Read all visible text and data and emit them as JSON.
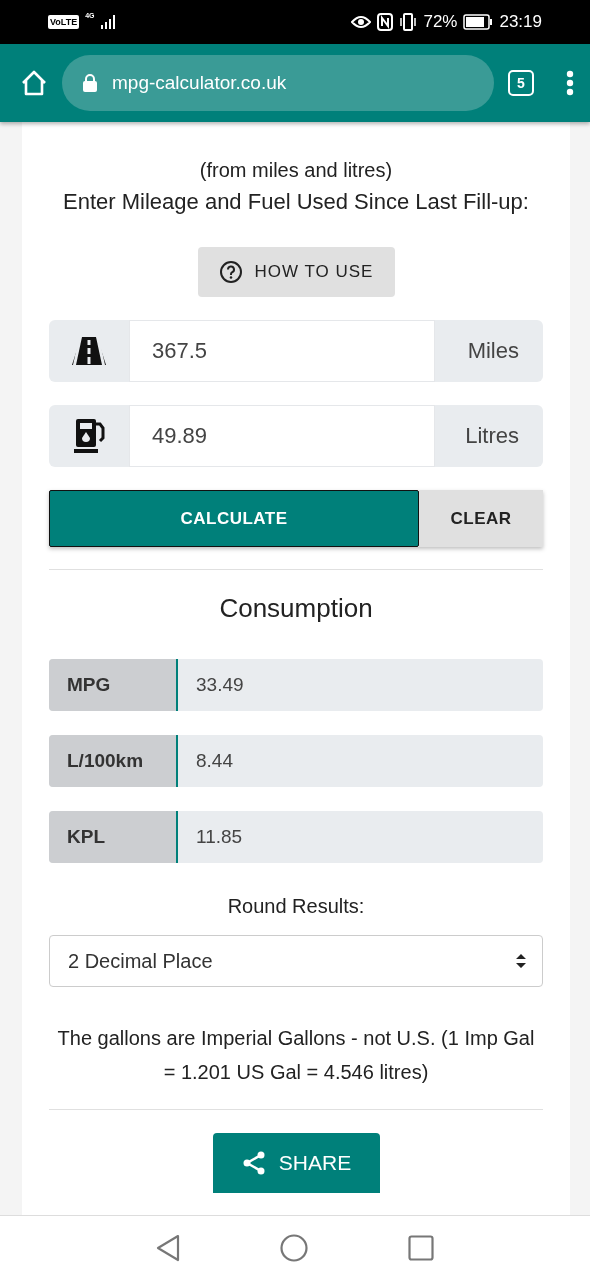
{
  "status_bar": {
    "volte": "VoLTE",
    "network": "4G",
    "battery": "72%",
    "time": "23:19"
  },
  "browser": {
    "url": "mpg-calculator.co.uk",
    "tab_count": "5"
  },
  "page": {
    "subtitle": "(from miles and litres)",
    "instruction": "Enter Mileage and Fuel Used Since Last Fill-up:",
    "help_button": "HOW TO USE",
    "inputs": [
      {
        "kind": "distance",
        "value": "367.5",
        "unit": "Miles"
      },
      {
        "kind": "fuel",
        "value": "49.89",
        "unit": "Litres"
      }
    ],
    "calculate_button": "CALCULATE",
    "clear_button": "CLEAR",
    "results_title": "Consumption",
    "results": [
      {
        "label": "MPG",
        "value": "33.49"
      },
      {
        "label": "L/100km",
        "value": "8.44"
      },
      {
        "label": "KPL",
        "value": "11.85"
      }
    ],
    "round_label": "Round Results:",
    "round_select": "2 Decimal Place",
    "note": "The gallons are Imperial Gallons - not U.S. (1 Imp Gal = 1.201 US Gal = 4.546 litres)",
    "share_button": "SHARE"
  }
}
